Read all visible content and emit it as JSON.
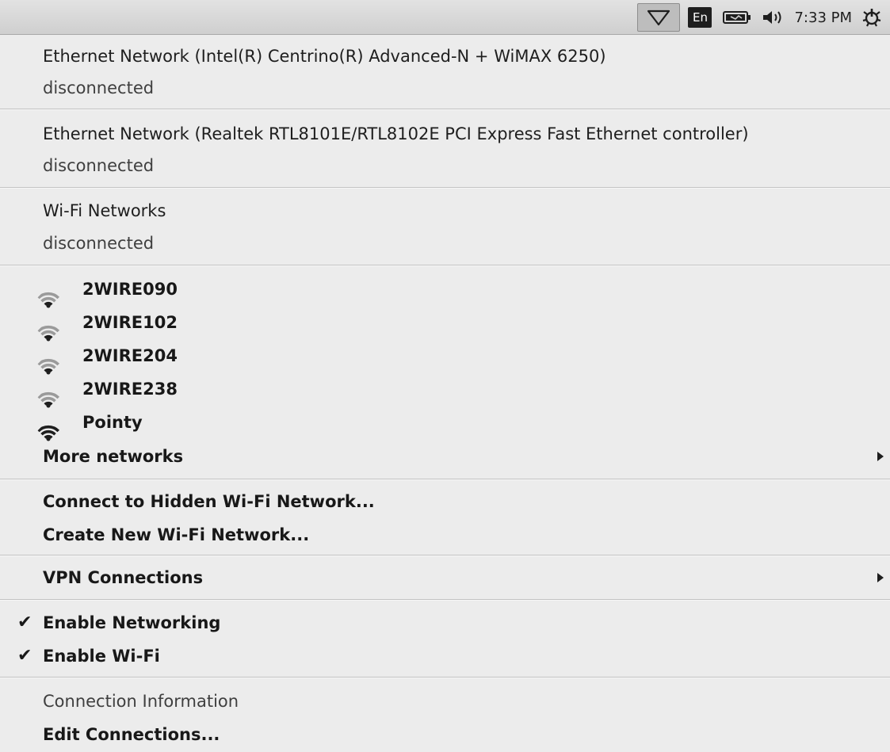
{
  "panel": {
    "language": "En",
    "clock": "7:33 PM",
    "icons": [
      "wifi-icon",
      "battery-icon",
      "volume-icon",
      "power-settings-icon"
    ]
  },
  "menu": {
    "ethernet1": {
      "title": "Ethernet Network (Intel(R) Centrino(R) Advanced-N + WiMAX 6250)",
      "status": "disconnected"
    },
    "ethernet2": {
      "title": "Ethernet Network (Realtek RTL8101E/RTL8102E PCI Express Fast Ethernet controller)",
      "status": "disconnected"
    },
    "wifi": {
      "title": "Wi-Fi Networks",
      "status": "disconnected"
    },
    "networks": [
      {
        "name": "2WIRE090",
        "signal": 0.6
      },
      {
        "name": "2WIRE102",
        "signal": 0.6
      },
      {
        "name": "2WIRE204",
        "signal": 0.6
      },
      {
        "name": "2WIRE238",
        "signal": 0.6
      },
      {
        "name": "Pointy",
        "signal": 1.0
      }
    ],
    "more_networks": "More networks",
    "connect_hidden": "Connect to Hidden Wi-Fi Network...",
    "create_new": "Create New Wi-Fi Network...",
    "vpn": "VPN Connections",
    "enable_networking": {
      "label": "Enable Networking",
      "checked": true,
      "mark": "✔"
    },
    "enable_wifi": {
      "label": "Enable Wi-Fi",
      "checked": true,
      "mark": "✔"
    },
    "connection_info": "Connection Information",
    "edit_connections": "Edit Connections..."
  },
  "colors": {
    "menu_bg": "#ececec",
    "panel_bg": "#d8d8d8",
    "text": "#1e1e1e",
    "muted_text": "#3f3f3f"
  }
}
